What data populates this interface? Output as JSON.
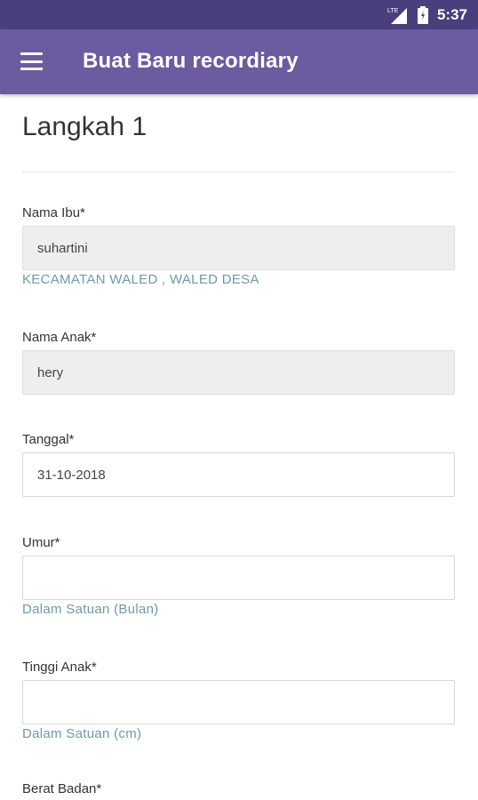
{
  "status_bar": {
    "time": "5:37",
    "icons": [
      "signal-icon",
      "battery-icon"
    ]
  },
  "app_bar": {
    "title": "Buat Baru recordiary",
    "menu_icon": "menu-icon"
  },
  "colors": {
    "status_bar_bg": "#4a3f7d",
    "app_bar_bg": "#6c5ba0",
    "hint_text": "#6f9aa6",
    "filled_field_bg": "#eeeeee"
  },
  "form": {
    "step_title": "Langkah 1",
    "nama_ibu": {
      "label": "Nama Ibu*",
      "value": "suhartini",
      "hint": "KECAMATAN WALED , WALED DESA"
    },
    "nama_anak": {
      "label": "Nama Anak*",
      "value": "hery"
    },
    "tanggal": {
      "label": "Tanggal*",
      "value": "31-10-2018"
    },
    "umur": {
      "label": "Umur*",
      "value": "",
      "hint": "Dalam Satuan (Bulan)"
    },
    "tinggi_anak": {
      "label": "Tinggi Anak*",
      "value": "",
      "hint": "Dalam Satuan (cm)"
    },
    "berat_badan": {
      "label": "Berat Badan*"
    }
  }
}
